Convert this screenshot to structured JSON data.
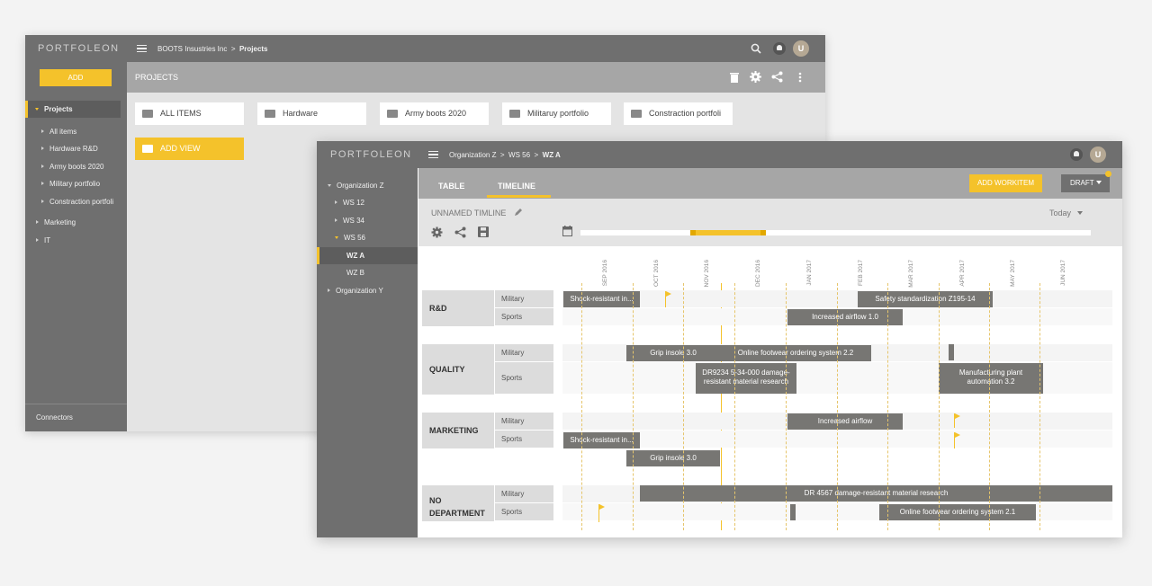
{
  "back": {
    "logo": "PORTFOLEON",
    "crumb_org": "BOOTS Insustries Inc",
    "crumb_sep": ">",
    "crumb_page": "Projects",
    "add_label": "ADD",
    "page_title": "PROJECTS",
    "tree": {
      "projects": "Projects",
      "items": [
        "All items",
        "Hardware R&D",
        "Army boots 2020",
        "Military portfolio",
        "Constraction portfoli"
      ],
      "marketing": "Marketing",
      "it": "IT"
    },
    "connectors": "Connectors",
    "tiles": [
      "ALL ITEMS",
      "Hardware",
      "Army boots 2020",
      "Militaruy portfolio",
      "Constraction portfoli"
    ],
    "add_view": "ADD VIEW",
    "avatar": "U"
  },
  "front": {
    "logo": "PORTFOLEON",
    "crumb": [
      "Organization Z",
      "WS 56",
      "WZ A"
    ],
    "crumb_sep": ">",
    "tree": {
      "org_z": "Organization Z",
      "ws12": "WS 12",
      "ws34": "WS 34",
      "ws56": "WS 56",
      "wza": "WZ A",
      "wzb": "WZ B",
      "org_y": "Organization Y"
    },
    "tabs": [
      "TABLE",
      "TIMELINE"
    ],
    "add_workitem": "ADD WORKITEM",
    "draft": "DRAFT",
    "timeline_name": "UNNAMED TIMLINE",
    "today": "Today",
    "avatar": "U",
    "months": [
      {
        "m": "SEP",
        "y": "2016"
      },
      {
        "m": "OCT",
        "y": "2016"
      },
      {
        "m": "NOV",
        "y": "2016"
      },
      {
        "m": "DEC",
        "y": "2016"
      },
      {
        "m": "JAN",
        "y": "2017"
      },
      {
        "m": "FEB",
        "y": "2017"
      },
      {
        "m": "MAR",
        "y": "2017"
      },
      {
        "m": "APR",
        "y": "2017"
      },
      {
        "m": "MAY",
        "y": "2017"
      },
      {
        "m": "JUN",
        "y": "2017"
      }
    ],
    "groups": [
      {
        "name": "R&D",
        "lanes": [
          "Military",
          "Sports"
        ]
      },
      {
        "name": "QUALITY",
        "lanes": [
          "Military",
          "Sports"
        ]
      },
      {
        "name": "MARKETING",
        "lanes": [
          "Military",
          "Sports"
        ]
      },
      {
        "name": "NO DEPARTMENT",
        "lanes": [
          "Military",
          "Sports"
        ]
      }
    ],
    "bars": {
      "b1": "Shock-resistant in...",
      "b2": "Safety standardization Z195-14",
      "b3": "Increased airflow 1.0",
      "b4": "Grip insole 3.0",
      "b5": "Online footwear ordering system 2.2",
      "b6": "DR9234 5-34-000  damage-resistant material  research",
      "b7": "Manufacturing plant automation 3.2",
      "b8": "Increased airflow",
      "b9": "Shock-resistant in...",
      "b10": "Grip insole 3.0",
      "b11": "DR 4567 damage-resistant material research",
      "b12": "Online footwear ordering system 2.1"
    }
  },
  "colors": {
    "accent": "#f4c22b",
    "chrome": "#6f6f6f",
    "bar": "#777673"
  }
}
